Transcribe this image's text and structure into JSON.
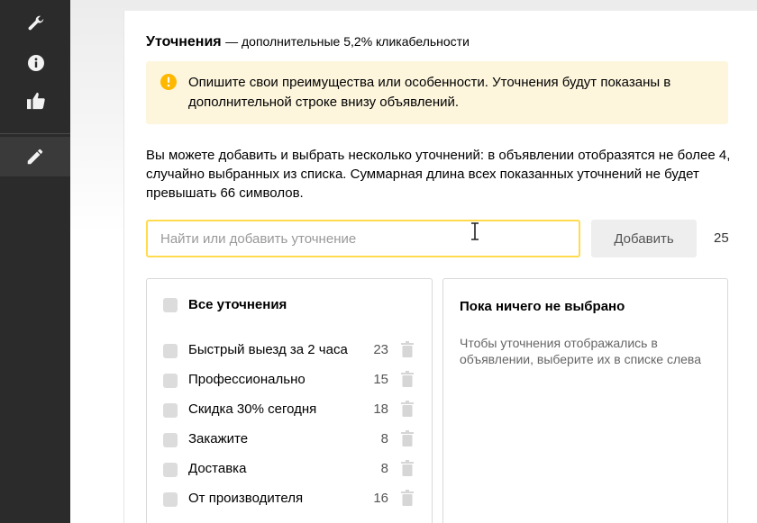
{
  "toolbar": {
    "tools": [
      {
        "icon": "wrench-icon"
      },
      {
        "icon": "info-icon"
      },
      {
        "icon": "thumbs-up-icon"
      },
      {
        "icon": "pencil-icon",
        "active": true
      }
    ]
  },
  "section": {
    "title": "Уточнения",
    "subtitle": "— дополнительные 5,2% кликабельности"
  },
  "hint": {
    "icon": "info-circle-icon",
    "text": "Опишите свои преимущества или особенности. Уточнения будут показаны в дополнительной строке внизу объявлений."
  },
  "description": "Вы можете добавить и выбрать несколько уточнений: в объявлении отобразятся не более 4, случайно выбранных из списка. Суммарная длина всех показанных уточнений не будет превышать 66 символов.",
  "search": {
    "placeholder": "Найти или добавить уточнение",
    "value": "",
    "add_label": "Добавить",
    "chars_left": "25"
  },
  "available": {
    "all_label": "Все уточнения",
    "items": [
      {
        "label": "Быстрый выезд за 2 часа",
        "count": "23"
      },
      {
        "label": "Профессионально",
        "count": "15"
      },
      {
        "label": "Скидка 30% сегодня",
        "count": "18"
      },
      {
        "label": "Закажите",
        "count": "8"
      },
      {
        "label": "Доставка",
        "count": "8"
      },
      {
        "label": "От производителя",
        "count": "16"
      }
    ]
  },
  "selected": {
    "title": "Пока ничего не выбрано",
    "text": "Чтобы уточнения отображались в объявлении, выберите их в списке слева"
  },
  "colors": {
    "accent_border": "#ffdb4d",
    "hint_bg": "#fdf6dd",
    "info_icon": "#ffb800",
    "sidebar": "#2b2b2b"
  }
}
